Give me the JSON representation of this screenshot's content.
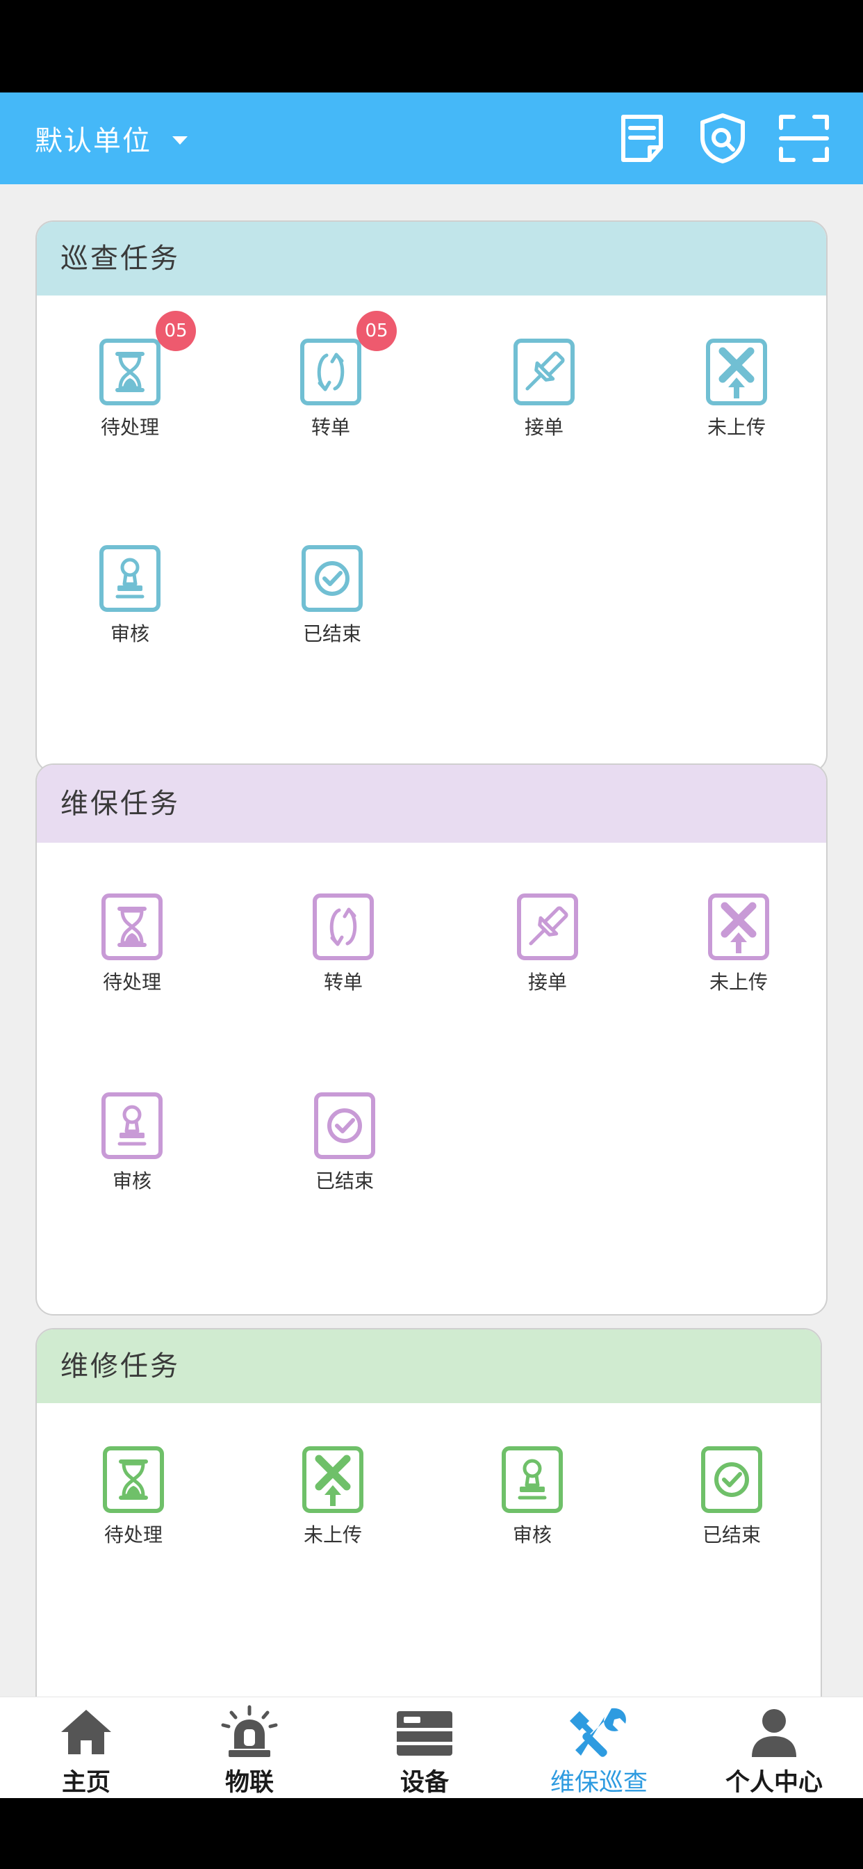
{
  "header": {
    "unit_name": "默认单位",
    "actions": [
      {
        "name": "notes-icon"
      },
      {
        "name": "shield-search-icon"
      },
      {
        "name": "scan-icon"
      }
    ]
  },
  "colors": {
    "header": "#45b8f8",
    "inspection": "#71bfd3",
    "inspection_head": "#c1e5ea",
    "maintenance": "#c89ad6",
    "maintenance_head": "#e8dcf1",
    "repair": "#6fc069",
    "repair_head": "#d0ebd0",
    "badge": "#ee5a6e",
    "tab_active": "#2e9be0",
    "tab_inactive": "#555555"
  },
  "panels": [
    {
      "title": "巡查任务",
      "items": [
        {
          "label": "待处理",
          "icon": "hourglass-icon",
          "badge": "05"
        },
        {
          "label": "转单",
          "icon": "transfer-icon",
          "badge": "05"
        },
        {
          "label": "接单",
          "icon": "pushpin-icon",
          "badge": ""
        },
        {
          "label": "未上传",
          "icon": "not-uploaded-icon",
          "badge": ""
        },
        {
          "label": "审核",
          "icon": "stamp-icon",
          "badge": ""
        },
        {
          "label": "已结束",
          "icon": "check-circle-icon",
          "badge": ""
        }
      ]
    },
    {
      "title": "维保任务",
      "items": [
        {
          "label": "待处理",
          "icon": "hourglass-icon"
        },
        {
          "label": "转单",
          "icon": "transfer-icon"
        },
        {
          "label": "接单",
          "icon": "pushpin-icon"
        },
        {
          "label": "未上传",
          "icon": "not-uploaded-icon"
        },
        {
          "label": "审核",
          "icon": "stamp-icon"
        },
        {
          "label": "已结束",
          "icon": "check-circle-icon"
        }
      ]
    },
    {
      "title": "维修任务",
      "items": [
        {
          "label": "待处理",
          "icon": "hourglass-icon"
        },
        {
          "label": "未上传",
          "icon": "not-uploaded-icon"
        },
        {
          "label": "审核",
          "icon": "stamp-icon"
        },
        {
          "label": "已结束",
          "icon": "check-circle-icon"
        }
      ]
    }
  ],
  "tabs": [
    {
      "label": "主页",
      "icon": "home-icon",
      "active": false
    },
    {
      "label": "物联",
      "icon": "alarm-light-icon",
      "active": false
    },
    {
      "label": "设备",
      "icon": "device-icon",
      "active": false
    },
    {
      "label": "维保巡查",
      "icon": "tools-icon",
      "active": true
    },
    {
      "label": "个人中心",
      "icon": "user-icon",
      "active": false
    }
  ]
}
